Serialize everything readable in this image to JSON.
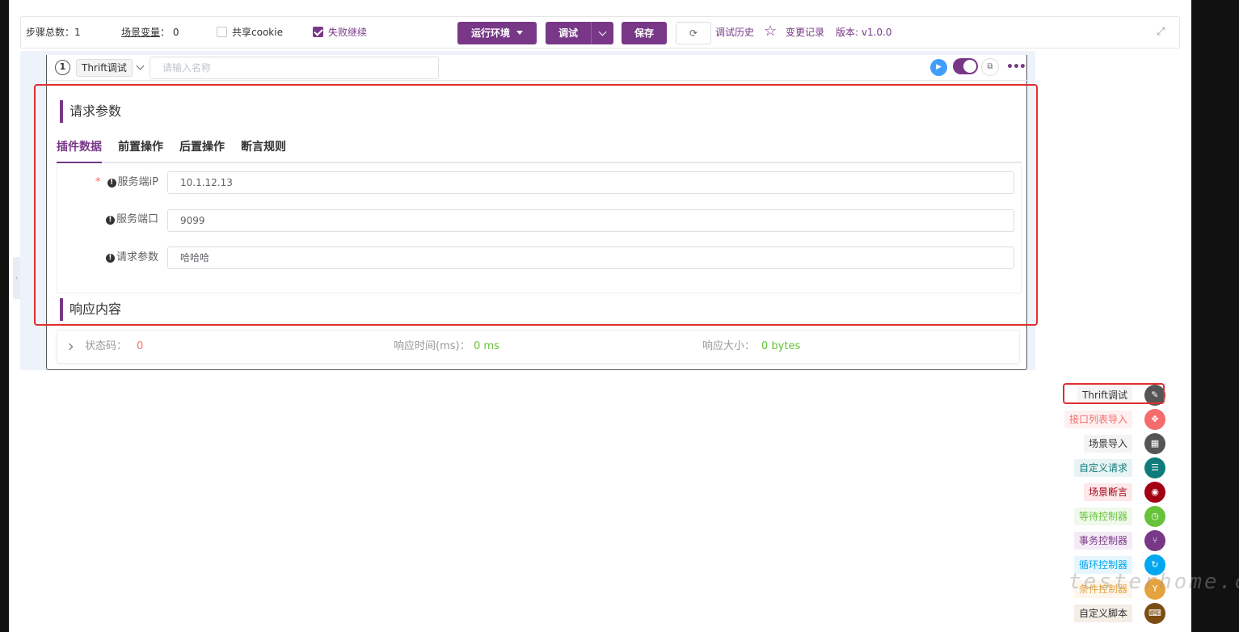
{
  "toolbar": {
    "steps_label": "步骤总数：1",
    "vars_label": "场景变量",
    "vars_count": "：  0",
    "share_cookie": "共享cookie",
    "fail_continue": "失败继续",
    "run_env": "运行环境",
    "debug": "调试",
    "save": "保存",
    "history": "调试历史",
    "changelog": "变更记录",
    "version": "版本: v1.0.0"
  },
  "step": {
    "number": "1",
    "type": "Thrift调试",
    "name_placeholder": "请输入名称"
  },
  "request": {
    "title": "请求参数",
    "tabs": [
      "插件数据",
      "前置操作",
      "后置操作",
      "断言规则"
    ],
    "fields": [
      {
        "label": "服务端iP",
        "value": "10.1.12.13",
        "required": true
      },
      {
        "label": "服务端口",
        "value": "9099",
        "required": false
      },
      {
        "label": "请求参数",
        "value": "哈哈哈",
        "required": false
      }
    ]
  },
  "response": {
    "title": "响应内容",
    "status_label": "状态码：",
    "status_value": "0",
    "time_label": "响应时间(ms)：",
    "time_value": "0 ms",
    "size_label": "响应大小：",
    "size_value": "0 bytes"
  },
  "menu": {
    "items": [
      {
        "label": "Thrift调试",
        "color": "#555555",
        "bg": "#f4f4f5",
        "fg": "#333333",
        "icon": "edit-icon"
      },
      {
        "label": "接口列表导入",
        "color": "#f56c6c",
        "bg": "#fef0f0",
        "fg": "#f56c6c",
        "icon": "move-icon"
      },
      {
        "label": "场景导入",
        "color": "#555555",
        "bg": "#f4f4f5",
        "fg": "#333333",
        "icon": "clapper-icon"
      },
      {
        "label": "自定义请求",
        "color": "#0f7b7b",
        "bg": "#e8f4f4",
        "fg": "#0f7b7b",
        "icon": "sliders-icon"
      },
      {
        "label": "场景断言",
        "color": "#a30014",
        "bg": "#fde8ea",
        "fg": "#a30014",
        "icon": "assert-icon"
      },
      {
        "label": "等待控制器",
        "color": "#67c23a",
        "bg": "#f0f9eb",
        "fg": "#67c23a",
        "icon": "clock-icon"
      },
      {
        "label": "事务控制器",
        "color": "#783887",
        "bg": "#f4ebf6",
        "fg": "#783887",
        "icon": "fork-icon"
      },
      {
        "label": "循环控制器",
        "color": "#02a7f0",
        "bg": "#e6f6fe",
        "fg": "#02a7f0",
        "icon": "loop-icon"
      },
      {
        "label": "条件控制器",
        "color": "#e6a23c",
        "bg": "#fdf6ec",
        "fg": "#e6a23c",
        "icon": "branch-icon"
      },
      {
        "label": "自定义脚本",
        "color": "#7b4d12",
        "bg": "#f4eee6",
        "fg": "#333333",
        "icon": "script-icon"
      }
    ]
  },
  "watermark": "testerhome.com",
  "colors": {
    "accent": "#783887",
    "highlight": "#e02e2e"
  }
}
